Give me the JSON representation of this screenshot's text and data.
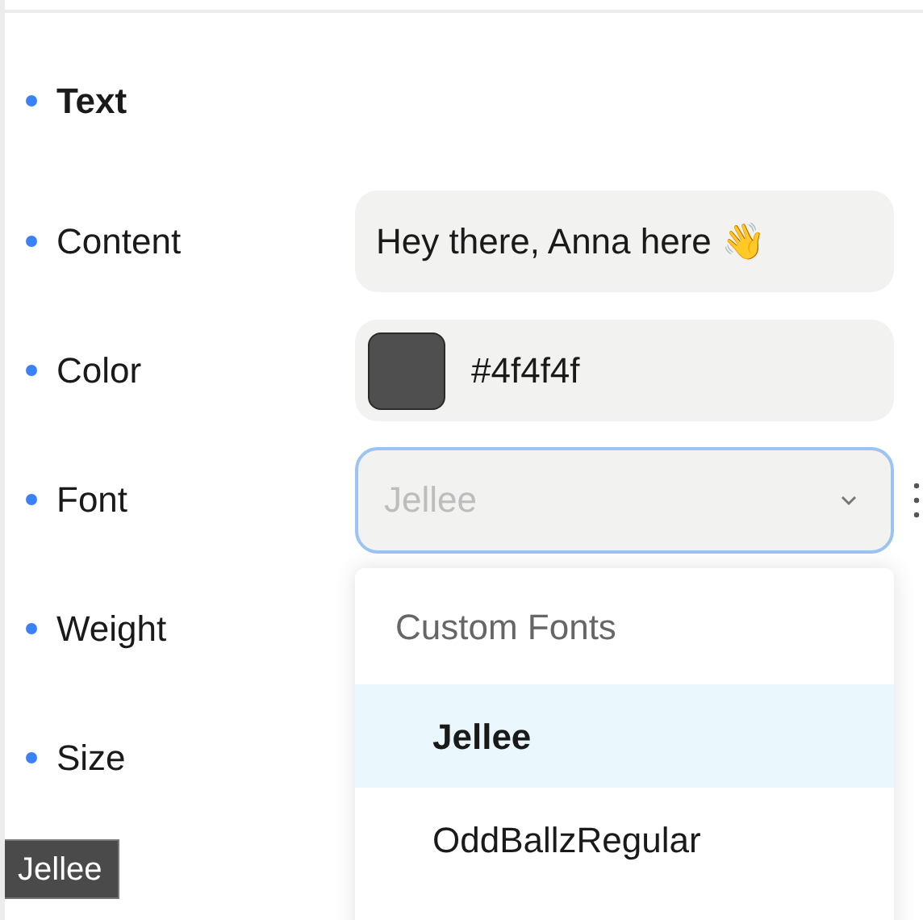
{
  "section": {
    "title": "Text"
  },
  "properties": [
    {
      "label": "Content",
      "kind": "text",
      "value": "Hey there, Anna here 👋"
    },
    {
      "label": "Color",
      "kind": "color",
      "value": "#4f4f4f",
      "color": "#4f4f4f"
    },
    {
      "label": "Font",
      "kind": "select",
      "placeholder": "Jellee",
      "focused": true
    },
    {
      "label": "Weight",
      "kind": "none"
    },
    {
      "label": "Size",
      "kind": "none"
    }
  ],
  "dropdown": {
    "group": "Custom Fonts",
    "options": [
      {
        "label": "Jellee",
        "selected": true
      },
      {
        "label": "OddBallzRegular",
        "selected": false
      }
    ]
  },
  "tooltip": "Jellee"
}
